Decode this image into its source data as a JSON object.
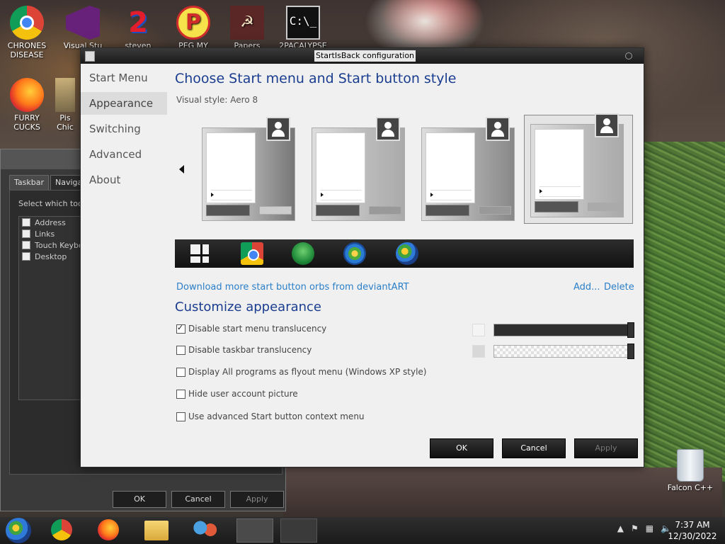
{
  "desktop": {
    "icons": [
      {
        "name": "chrome-icon",
        "label": "CHRONES DISEASE"
      },
      {
        "name": "visual-studio-icon",
        "label": "Visual Stu"
      },
      {
        "name": "steven-icon",
        "label": "steven"
      },
      {
        "name": "peg-icon",
        "label": "PEG MY WIFE!"
      },
      {
        "name": "papers-icon",
        "label": "Papers"
      },
      {
        "name": "cmd-icon",
        "label": "2PACALYPSE"
      },
      {
        "name": "firefox-icon",
        "label": "FURRY CUCKS"
      },
      {
        "name": "pistol-icon",
        "label": "Pis Chic"
      },
      {
        "name": "recycle-bin-icon",
        "label": "Falcon C++"
      }
    ]
  },
  "bg_window": {
    "tabs": [
      "Taskbar",
      "Navigat"
    ],
    "hint": "Select which toolb",
    "toolbars": [
      "Address",
      "Links",
      "Touch Keyboa",
      "Desktop"
    ],
    "buttons": {
      "ok": "OK",
      "cancel": "Cancel",
      "apply": "Apply"
    }
  },
  "config": {
    "title": "StartIsBack configuration",
    "nav": [
      "Start Menu",
      "Appearance",
      "Switching",
      "Advanced",
      "About"
    ],
    "active_nav": "Appearance",
    "heading": "Choose Start menu and Start button style",
    "visual_style_label": "Visual style:",
    "visual_style_value": "Aero 8",
    "download_link": "Download more start button orbs from deviantART",
    "add_link": "Add...",
    "delete_link": "Delete",
    "customize_heading": "Customize appearance",
    "options": [
      {
        "label": "Disable start menu translucency",
        "checked": true
      },
      {
        "label": "Disable taskbar translucency",
        "checked": false
      },
      {
        "label": "Display All programs as flyout menu (Windows XP style)",
        "checked": false
      },
      {
        "label": "Hide user account picture",
        "checked": false
      },
      {
        "label": "Use advanced Start button context menu",
        "checked": false
      }
    ],
    "buttons": {
      "ok": "OK",
      "cancel": "Cancel",
      "apply": "Apply"
    },
    "orbs": [
      "windows8-orb",
      "chrome-orb",
      "clover-orb",
      "windows7-orb-a",
      "windows7-orb-b"
    ]
  },
  "taskbar": {
    "clock_time": "7:37 AM",
    "clock_date": "12/30/2022",
    "tray_icons": [
      "show-hidden-icon",
      "flag-icon",
      "network-icon",
      "volume-icon"
    ]
  },
  "colors": {
    "accent": "#1a3d8f",
    "link": "#2a7fc8"
  }
}
